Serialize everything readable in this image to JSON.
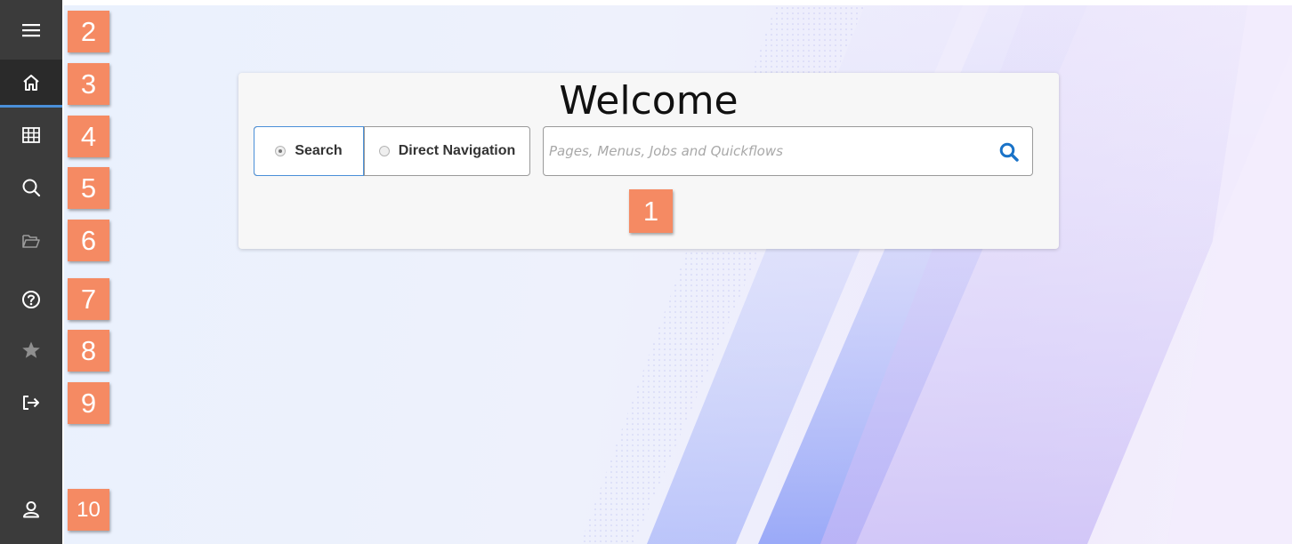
{
  "sidebar": {
    "items": [
      {
        "icon": "hamburger-menu-icon",
        "badge": "2"
      },
      {
        "icon": "home-icon",
        "badge": "3",
        "active": true
      },
      {
        "icon": "grid-icon",
        "badge": "4"
      },
      {
        "icon": "search-icon",
        "badge": "5"
      },
      {
        "icon": "folder-open-icon",
        "badge": "6"
      },
      {
        "icon": "help-icon",
        "badge": "7"
      },
      {
        "icon": "star-icon",
        "badge": "8"
      },
      {
        "icon": "sign-out-icon",
        "badge": "9"
      },
      {
        "icon": "user-icon",
        "badge": "10"
      }
    ]
  },
  "welcome": {
    "title": "Welcome",
    "mode_search_label": "Search",
    "mode_direct_label": "Direct Navigation",
    "selected_mode": "Search",
    "search_placeholder": "Pages, Menus, Jobs and Quickflows",
    "search_value": "",
    "badge": "1"
  },
  "colors": {
    "sidebar_bg": "#3b3b3b",
    "accent_blue": "#4a8fd8",
    "badge_orange": "#f58a63",
    "search_icon_blue": "#1a73c8"
  }
}
